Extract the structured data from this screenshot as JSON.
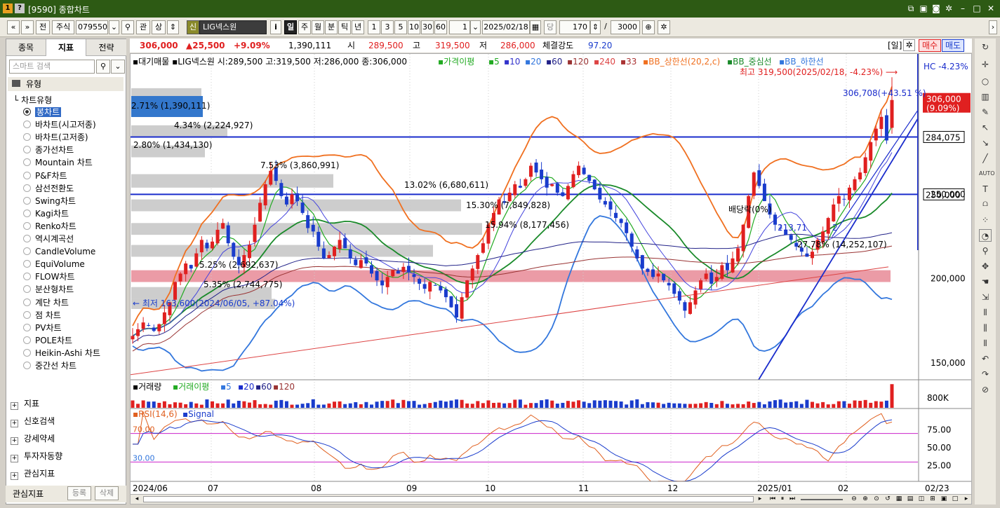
{
  "window": {
    "title": "[9590] 종합차트",
    "icon1": "1",
    "icon2": "?"
  },
  "toolbar": {
    "nav_prev": "«",
    "nav_down": "»",
    "btn_jeon": "전",
    "market": "주식",
    "code": "079550",
    "btn_gwan": "관",
    "btn_sang": "상",
    "badge_sin": "신",
    "stock_name": "LIG넥스원",
    "btn_info": "i",
    "periods": [
      "일",
      "주",
      "월",
      "분",
      "틱",
      "년"
    ],
    "active_period": "일",
    "intervals": [
      "1",
      "3",
      "5",
      "10",
      "30",
      "60"
    ],
    "count_value": "1",
    "date": "2025/02/18",
    "btn_dang": "당",
    "bar_count": "170",
    "slash": "/",
    "max_count": "3000"
  },
  "left_panel": {
    "tabs": [
      "종목",
      "지표",
      "전략"
    ],
    "active_tab": "지표",
    "search_placeholder": "스마트 검색",
    "section_type": "유형",
    "tree_header": "차트유형",
    "chart_types": [
      "봉차트",
      "바차트(시고저종)",
      "바차트(고저종)",
      "종가선차트",
      "Mountain 차트",
      "P&F차트",
      "삼선전환도",
      "Swing차트",
      "Kagi차트",
      "Renko차트",
      "역시계곡선",
      "CandleVolume",
      "EquiVolume",
      "FLOW차트",
      "분산형차트",
      "계단 차트",
      "점 차트",
      "PV차트",
      "POLE차트",
      "Heikin-Ashi 차트",
      "중간선 차트"
    ],
    "selected_type": "봉차트",
    "sections": [
      "지표",
      "신호검색",
      "강세약세",
      "투자자동향",
      "관심지표"
    ],
    "footer_label": "관심지표",
    "btn_add": "등록",
    "btn_delete": "삭제"
  },
  "quote_bar": {
    "price": "306,000",
    "change": "▲25,500",
    "change_pct": "+9.09%",
    "volume": "1,390,111",
    "open_label": "시",
    "open": "289,500",
    "high_label": "고",
    "high": "319,500",
    "low_label": "저",
    "low": "286,000",
    "strength_label": "체결강도",
    "strength": "97.20",
    "period_label": "[일]",
    "buy_label": "매수",
    "sell_label": "매도"
  },
  "legend": {
    "line_prefix": "대기매물",
    "ohlc_text": "LIG넥스원 시:289,500 고:319,500 저:286,000 종:306,000",
    "ma_label": "가격이평",
    "ma_periods": [
      {
        "label": "5",
        "color": "#22aa22"
      },
      {
        "label": "10",
        "color": "#3333cc"
      },
      {
        "label": "20",
        "color": "#3377dd"
      },
      {
        "label": "60",
        "color": "#222288"
      },
      {
        "label": "120",
        "color": "#993333"
      },
      {
        "label": "240",
        "color": "#dd4444"
      },
      {
        "label": "33",
        "color": "#aa3333"
      }
    ],
    "bb_upper": "BB_상한선(20,2,c)",
    "bb_mid": "BB_중심선",
    "bb_lower": "BB_하한선",
    "hc_label": "HC -4.23%"
  },
  "annotations": {
    "max_text": "최고 319,500(2025/02/18, -4.23%)",
    "min_text": "최저 163,600(2024/06/05, +87.04%)",
    "trend_text": "306,708(+43.51 %)",
    "dividend_text": "배당락(0%)",
    "mid_text": "213,71",
    "mid_text2": "2"
  },
  "price_axis": {
    "labels": [
      {
        "v": 250000,
        "t": "250,000"
      },
      {
        "v": 200000,
        "t": "200,000"
      },
      {
        "v": 150000,
        "t": "150,000"
      }
    ],
    "current_tag": "306,000",
    "current_tag_pct": "(9.09%)",
    "line_tag": "284,075"
  },
  "volume_panel": {
    "title": "거래량",
    "ma_label": "거래이평",
    "periods": [
      "5",
      "20",
      "60",
      "120"
    ],
    "axis_label": "800K"
  },
  "rsi_panel": {
    "title": "RSI(14,6)",
    "signal": "Signal",
    "level_high": "70.00",
    "level_low": "30.00",
    "axis": [
      "75.00",
      "50.00",
      "25.00"
    ]
  },
  "x_axis": [
    "2024/06",
    "07",
    "08",
    "09",
    "10",
    "11",
    "12",
    "2025/01",
    "02",
    "02/23"
  ],
  "chart_data": {
    "type": "candlestick",
    "x_range": [
      "2024-06-03",
      "2025-02-18"
    ],
    "ylim": [
      140000,
      330000
    ],
    "closes": [
      166000,
      170000,
      174000,
      172000,
      169000,
      173000,
      180000,
      186000,
      198000,
      203000,
      209000,
      206000,
      215000,
      223000,
      218000,
      222000,
      229000,
      233000,
      221000,
      213000,
      208000,
      214000,
      220000,
      232000,
      245000,
      256000,
      264000,
      258000,
      249000,
      244000,
      250000,
      246000,
      239000,
      230000,
      228000,
      219000,
      212000,
      214000,
      219000,
      223000,
      218000,
      212000,
      208000,
      211000,
      209000,
      203000,
      199000,
      196000,
      201000,
      205000,
      203000,
      207000,
      204000,
      201000,
      197000,
      194000,
      198000,
      196000,
      193000,
      189000,
      183000,
      177000,
      189000,
      199000,
      206000,
      214000,
      221000,
      232000,
      239000,
      247000,
      245000,
      251000,
      256000,
      254000,
      259000,
      267000,
      263000,
      259000,
      254000,
      256000,
      251000,
      249000,
      255000,
      262000,
      267000,
      262000,
      258000,
      253000,
      247000,
      244000,
      241000,
      236000,
      233000,
      227000,
      219000,
      212000,
      206000,
      204000,
      201000,
      203000,
      199000,
      196000,
      191000,
      187000,
      181000,
      186000,
      193000,
      199000,
      203000,
      197000,
      201000,
      208000,
      205000,
      212000,
      218000,
      232000,
      249000,
      263000,
      255000,
      246000,
      238000,
      232000,
      230000,
      226000,
      223000,
      219000,
      216000,
      213000,
      216000,
      223000,
      228000,
      236000,
      244000,
      249000,
      247000,
      254000,
      259000,
      263000,
      272000,
      281000,
      289000,
      296000,
      282000,
      306000
    ],
    "volume_max": 1400000,
    "rsi_levels": [
      70,
      30
    ]
  },
  "colors": {
    "up": "#e02020",
    "down": "#1a3ccc",
    "bb": "#f07020",
    "titlebar": "#2d5a14",
    "band_red": "#e88a96",
    "band_gray": "#c8c8c8"
  }
}
